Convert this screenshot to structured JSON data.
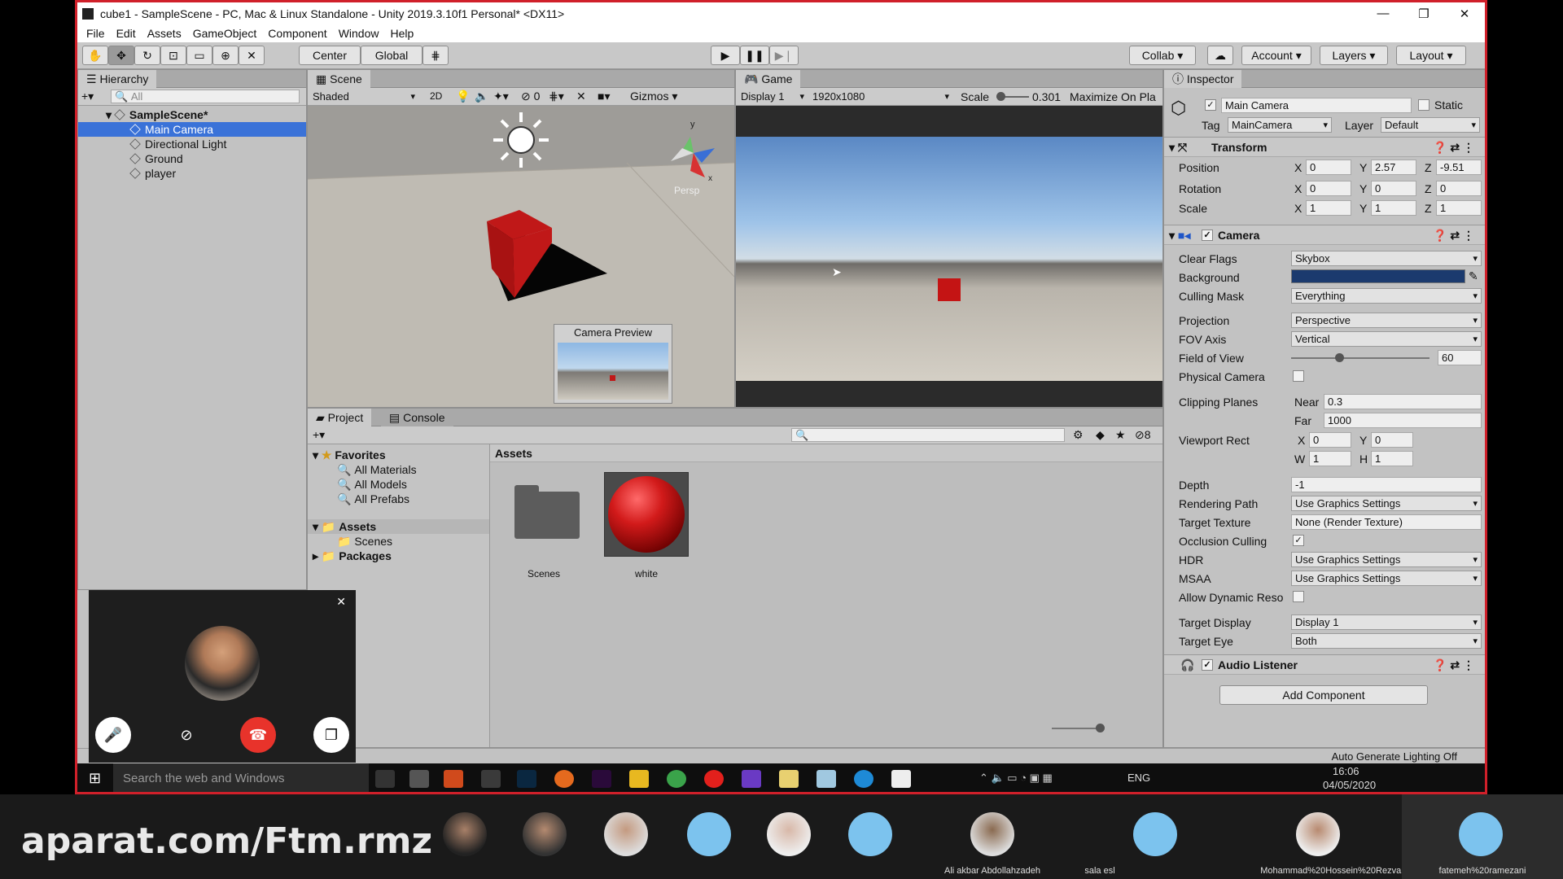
{
  "window": {
    "title": "cube1 - SampleScene - PC, Mac & Linux Standalone - Unity 2019.3.10f1 Personal* <DX11>",
    "controls": [
      "—",
      "❐",
      "✕"
    ]
  },
  "menu": [
    "File",
    "Edit",
    "Assets",
    "GameObject",
    "Component",
    "Window",
    "Help"
  ],
  "toolbar": {
    "pivot": "Center",
    "space": "Global",
    "collab": "Collab",
    "account": "Account",
    "layers": "Layers",
    "layout": "Layout"
  },
  "hierarchy": {
    "tab": "Hierarchy",
    "search_placeholder": "All",
    "scene": "SampleScene*",
    "items": [
      "Main Camera",
      "Directional Light",
      "Ground",
      "player"
    ]
  },
  "scene": {
    "tab": "Scene",
    "shading": "Shaded",
    "mode2d": "2D",
    "fx_count": "0",
    "gizmos": "Gizmos",
    "persp": "Persp",
    "camera_preview": "Camera Preview"
  },
  "game": {
    "tab": "Game",
    "display": "Display 1",
    "resolution": "1920x1080",
    "scale_label": "Scale",
    "scale_value": "0.301",
    "maximize": "Maximize On Pla"
  },
  "project": {
    "tab_project": "Project",
    "tab_console": "Console",
    "badge": "8",
    "favorites": "Favorites",
    "fav_items": [
      "All Materials",
      "All Models",
      "All Prefabs"
    ],
    "assets_folder": "Assets",
    "assets_sub": [
      "Scenes"
    ],
    "packages": "Packages",
    "breadcrumb": "Assets",
    "files": [
      "Scenes",
      "white"
    ]
  },
  "inspector": {
    "tab": "Inspector",
    "object_name": "Main Camera",
    "static": "Static",
    "tag_label": "Tag",
    "tag": "MainCamera",
    "layer_label": "Layer",
    "layer": "Default",
    "transform": {
      "title": "Transform",
      "position": {
        "label": "Position",
        "x": "0",
        "y": "2.57",
        "z": "-9.51"
      },
      "rotation": {
        "label": "Rotation",
        "x": "0",
        "y": "0",
        "z": "0"
      },
      "scale": {
        "label": "Scale",
        "x": "1",
        "y": "1",
        "z": "1"
      }
    },
    "camera": {
      "title": "Camera",
      "clear_flags": {
        "label": "Clear Flags",
        "value": "Skybox"
      },
      "background": {
        "label": "Background"
      },
      "culling_mask": {
        "label": "Culling Mask",
        "value": "Everything"
      },
      "projection": {
        "label": "Projection",
        "value": "Perspective"
      },
      "fov_axis": {
        "label": "FOV Axis",
        "value": "Vertical"
      },
      "fov": {
        "label": "Field of View",
        "value": "60"
      },
      "physical": {
        "label": "Physical Camera"
      },
      "clipping": {
        "label": "Clipping Planes",
        "near_label": "Near",
        "near": "0.3",
        "far_label": "Far",
        "far": "1000"
      },
      "viewport": {
        "label": "Viewport Rect",
        "x": "0",
        "y": "0",
        "w": "1",
        "h": "1"
      },
      "depth": {
        "label": "Depth",
        "value": "-1"
      },
      "rendering_path": {
        "label": "Rendering Path",
        "value": "Use Graphics Settings"
      },
      "target_texture": {
        "label": "Target Texture",
        "value": "None (Render Texture)"
      },
      "occlusion": {
        "label": "Occlusion Culling"
      },
      "hdr": {
        "label": "HDR",
        "value": "Use Graphics Settings"
      },
      "msaa": {
        "label": "MSAA",
        "value": "Use Graphics Settings"
      },
      "dynamic": {
        "label": "Allow Dynamic Reso"
      },
      "target_display": {
        "label": "Target Display",
        "value": "Display 1"
      },
      "target_eye": {
        "label": "Target Eye",
        "value": "Both"
      }
    },
    "audio": {
      "title": "Audio Listener"
    },
    "add_component": "Add Component"
  },
  "statusbar": "Auto Generate Lighting Off",
  "taskbar": {
    "search_placeholder": "Search the web and Windows",
    "lang": "ENG",
    "time": "16:06",
    "date": "04/05/2020"
  },
  "watermark": "aparat.com/Ftm.rmz",
  "participants": [
    "Ali akbar Abdollahzadeh",
    "sala esl",
    "Mohammad%20Hossein%20Rezvani",
    "fatemeh%20ramezani"
  ],
  "colors": {
    "selection": "#3a72d8",
    "accent_red": "#d0202a",
    "camera_bg": "#1b3a6e"
  }
}
